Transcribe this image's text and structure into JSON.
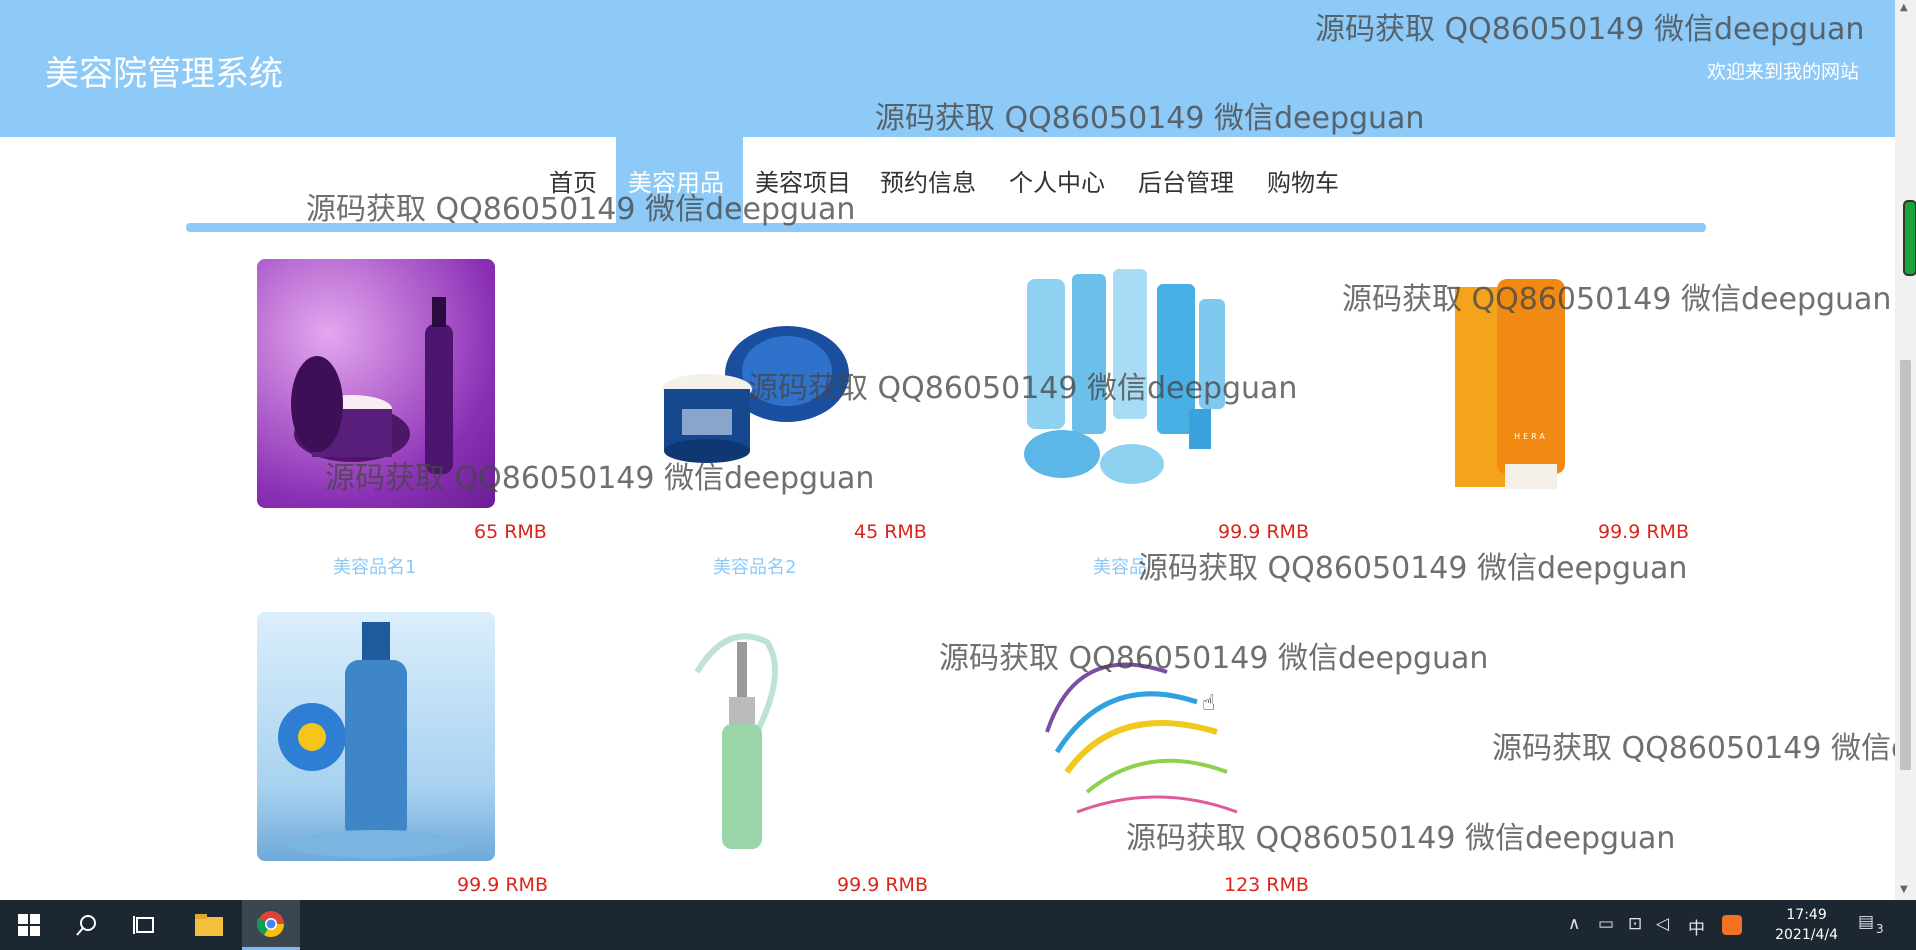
{
  "header": {
    "title": "美容院管理系统",
    "welcome": "欢迎来到我的网站"
  },
  "nav": {
    "items": [
      "首页",
      "美容用品",
      "美容项目",
      "预约信息",
      "个人中心",
      "后台管理",
      "购物车"
    ],
    "active": "美容用品"
  },
  "products": [
    {
      "price": "65 RMB",
      "name": "美容品名1"
    },
    {
      "price": "45 RMB",
      "name": "美容品名2"
    },
    {
      "price": "99.9 RMB",
      "name": "美容品"
    },
    {
      "price": "99.9 RMB",
      "name": ""
    },
    {
      "price": "99.9 RMB",
      "name": ""
    },
    {
      "price": "99.9 RMB",
      "name": ""
    },
    {
      "price": "123 RMB",
      "name": ""
    }
  ],
  "watermark": "源码获取 QQ86050149 微信deepguan",
  "taskbar": {
    "time": "17:49",
    "date": "2021/4/4",
    "ime": "中",
    "notifications": "3"
  },
  "colors": {
    "header": "#8ecaf7",
    "price": "#d9251c",
    "name": "#8ecaf7",
    "taskbar": "#1c2731"
  }
}
